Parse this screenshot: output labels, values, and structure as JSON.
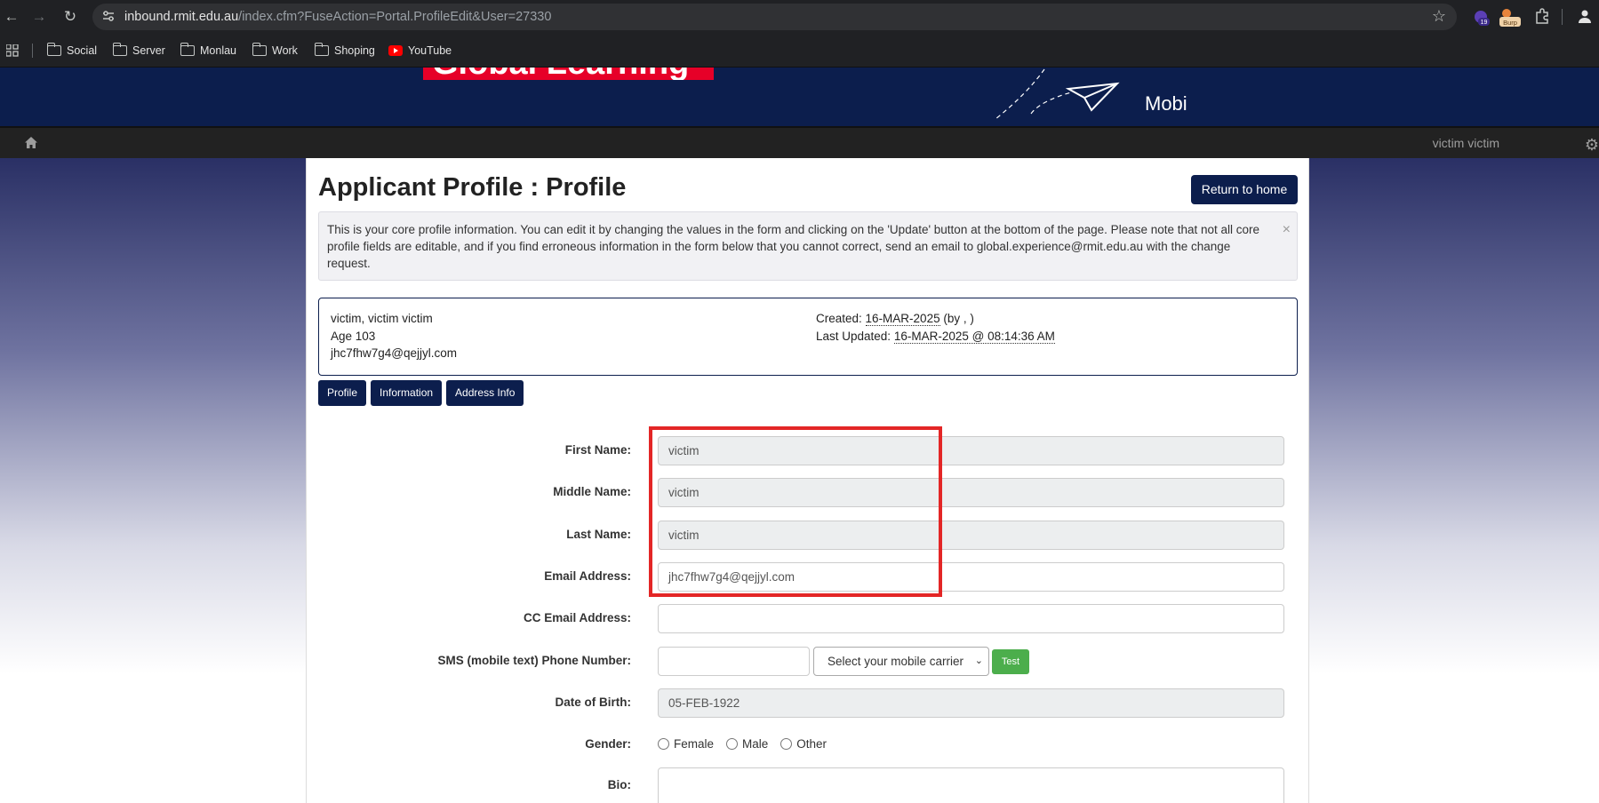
{
  "browser": {
    "url_host": "inbound.rmit.edu.au",
    "url_path": "/index.cfm?FuseAction=Portal.ProfileEdit&User=27330",
    "extension_badge": "19",
    "burp_label": "Burp",
    "bookmarks": [
      "Social",
      "Server",
      "Monlau",
      "Work",
      "Shoping",
      "YouTube"
    ]
  },
  "site": {
    "brand_text": "Global Learning",
    "mobi_text": "Mobi",
    "user_name": "victim victim"
  },
  "page": {
    "title": "Applicant Profile : Profile",
    "return_button": "Return to home",
    "alert_text": "This is your core profile information. You can edit it by changing the values in the form and clicking on the 'Update' button at the bottom of the page. Please note that not all core profile fields are editable, and if you find erroneous information in the form below that you cannot correct, send an email to global.experience@rmit.edu.au with the change request.",
    "alert_close": "×"
  },
  "summary": {
    "name": "victim, victim victim",
    "age": "Age 103",
    "email": "jhc7fhw7g4@qejjyl.com",
    "created_label": "Created:",
    "created_date": "16-MAR-2025",
    "created_by": "(by , )",
    "updated_label": "Last Updated:",
    "updated_date": "16-MAR-2025 @ 08:14:36 AM"
  },
  "tabs": [
    "Profile",
    "Information",
    "Address Info"
  ],
  "form": {
    "first_name_label": "First Name:",
    "first_name": "victim",
    "middle_name_label": "Middle Name:",
    "middle_name": "victim",
    "last_name_label": "Last Name:",
    "last_name": "victim",
    "email_label": "Email Address:",
    "email": "jhc7fhw7g4@qejjyl.com",
    "cc_email_label": "CC Email Address:",
    "cc_email": "",
    "sms_label": "SMS (mobile text) Phone Number:",
    "carrier_placeholder": "Select your mobile carrier",
    "test_button": "Test",
    "dob_label": "Date of Birth:",
    "dob": "05-FEB-1922",
    "gender_label": "Gender:",
    "gender_options": [
      "Female",
      "Male",
      "Other"
    ],
    "bio_label": "Bio:"
  },
  "colors": {
    "brand_navy": "#0c1e4d",
    "brand_red": "#e60028",
    "highlight": "#e32626",
    "test_green": "#4cae4c"
  }
}
